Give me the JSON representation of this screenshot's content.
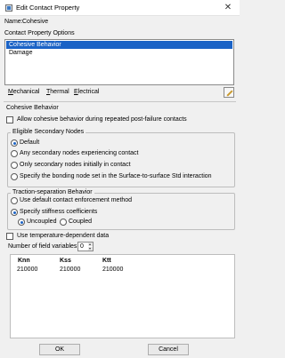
{
  "window": {
    "title": "Edit Contact Property"
  },
  "name": {
    "label": "Name:",
    "value": "Cohesive"
  },
  "contact_property_options": {
    "label": "Contact Property Options",
    "items": [
      "Cohesive Behavior",
      "Damage"
    ],
    "selected": "Cohesive Behavior"
  },
  "menus": [
    {
      "first": "M",
      "rest": "echanical"
    },
    {
      "first": "T",
      "rest": "hermal"
    },
    {
      "first": "E",
      "rest": "lectrical"
    }
  ],
  "section": {
    "title": "Cohesive Behavior"
  },
  "allow_checkbox": {
    "label": "Allow cohesive behavior during repeated post-failure contacts"
  },
  "eligible": {
    "title": "Eligible Secondary Nodes",
    "options": [
      "Default",
      "Any secondary nodes experiencing contact",
      "Only secondary nodes initially in contact",
      "Specify the bonding node set in the Surface-to-surface Std interaction"
    ],
    "selected_index": 0
  },
  "traction": {
    "title": "Traction-separation Behavior",
    "method_options": [
      "Use default contact enforcement method",
      "Specify stiffness coefficients"
    ],
    "selected_index": 1,
    "coupling_options": [
      "Uncoupled",
      "Coupled"
    ],
    "coupling_selected": 0
  },
  "temp_checkbox": {
    "label": "Use temperature-dependent data"
  },
  "field_variables": {
    "label": "Number of field variables:",
    "value": "0"
  },
  "table": {
    "columns": [
      "Knn",
      "Kss",
      "Ktt"
    ],
    "rows": [
      [
        "210000",
        "210000",
        "210000"
      ]
    ]
  },
  "buttons": {
    "ok": "OK",
    "cancel": "Cancel"
  }
}
